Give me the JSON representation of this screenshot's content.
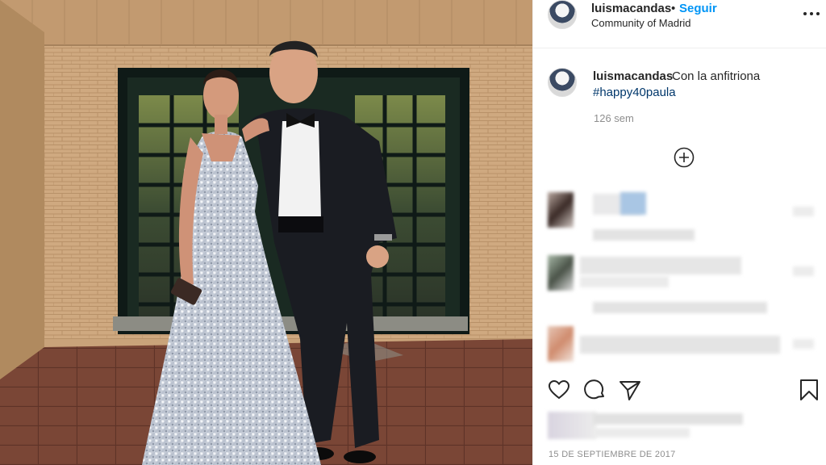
{
  "post": {
    "header": {
      "username": "luismacandas",
      "separator": "•",
      "follow_label": "Seguir",
      "location": "Community of Madrid",
      "more_icon": "more-horizontal-icon"
    },
    "caption": {
      "username": "luismacandas",
      "text": "Con la anfitriona",
      "hashtag": "#happy40paula",
      "time_ago": "126 sem"
    },
    "load_more_icon": "plus-circle-icon",
    "actions": {
      "like_icon": "heart-icon",
      "comment_icon": "comment-icon",
      "share_icon": "send-icon",
      "save_icon": "bookmark-icon"
    },
    "date": "15 DE SEPTIEMBRE DE 2017"
  },
  "colors": {
    "link_blue": "#0095f6",
    "hashtag_blue": "#00376b",
    "muted": "#8e8e8e",
    "text": "#262626"
  }
}
